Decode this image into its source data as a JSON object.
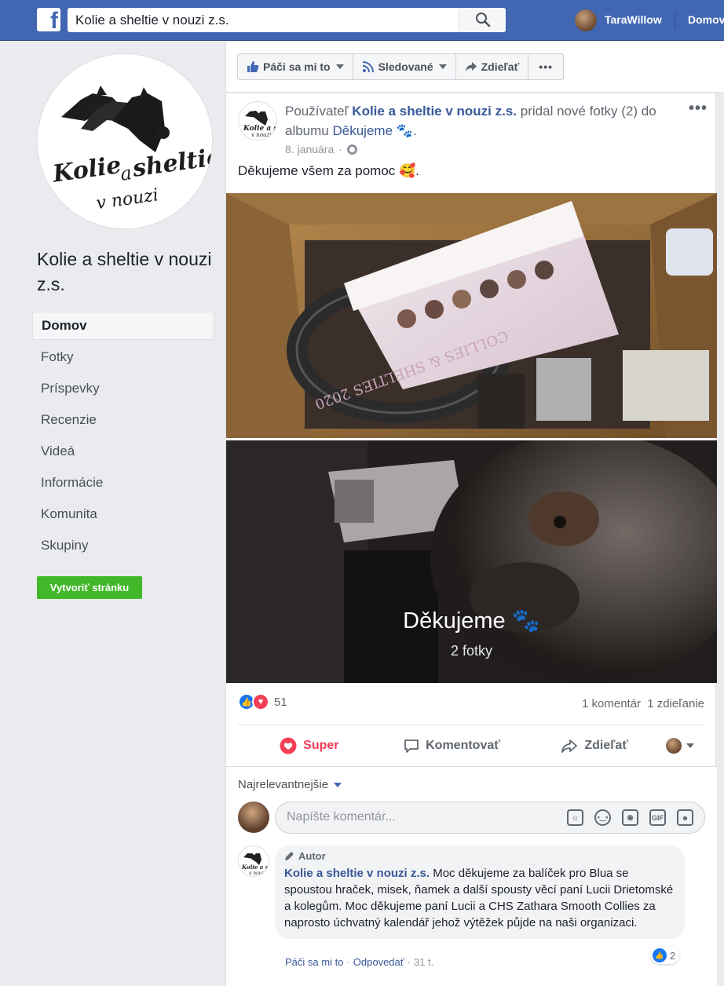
{
  "topbar": {
    "logo_letter": "f",
    "search_value": "Kolie a sheltie v nouzi z.s.",
    "user_name": "TaraWillow",
    "home_label": "Domov"
  },
  "page": {
    "name": "Kolie a sheltie v nouzi z.s.",
    "logo_text_line1": "Kolie a sheltie",
    "logo_text_line2": "v nouzi"
  },
  "nav": {
    "items": [
      {
        "label": "Domov",
        "active": true
      },
      {
        "label": "Fotky"
      },
      {
        "label": "Príspevky"
      },
      {
        "label": "Recenzie"
      },
      {
        "label": "Videá"
      },
      {
        "label": "Informácie"
      },
      {
        "label": "Komunita"
      },
      {
        "label": "Skupiny"
      }
    ],
    "create_button": "Vytvoriť stránku"
  },
  "actionbar": {
    "like_label": "Páči sa mi to",
    "follow_label": "Sledované",
    "share_label": "Zdieľať",
    "more_label": "•••"
  },
  "post": {
    "header_prefix": "Používateľ",
    "author": "Kolie a sheltie v nouzi z.s.",
    "header_middle": "pridal nové fotky (2) do albumu",
    "album_link": "Děkujeme",
    "header_suffix": "🐾.",
    "date": "8. januára",
    "more_dots": "•••",
    "text": "Děkujeme všem za pomoc 🥰.",
    "album_title": "Děkujeme 🐾",
    "album_count": "2 fotky",
    "reaction_count": "51",
    "comments_count": "1 komentár",
    "shares_count": "1 zdieľanie",
    "actions": {
      "super": "Super",
      "comment": "Komentovať",
      "share": "Zdieľať"
    }
  },
  "comments": {
    "sort_label": "Najrelevantnejšie",
    "input_placeholder": "Napíšte komentár...",
    "icons": [
      "sticker-icon",
      "emoji-icon",
      "camera-icon",
      "gif-icon",
      "sticker-face-icon"
    ],
    "gif_label": "GIF",
    "items": [
      {
        "badge": "Autor",
        "author": "Kolie a sheltie v nouzi z.s.",
        "text": "Moc děkujeme za balíček pro Blua se spoustou hraček, misek, ňamek a další spousty věcí paní Lucii Drietomské a kolegům. Moc děkujeme paní Lucii a CHS Zathara Smooth Collies za naprosto úchvatný kalendář jehož výtěžek půjde na naši organizaci.",
        "like_label": "Páči sa mi to",
        "reply_label": "Odpovedať",
        "time": "31 t.",
        "reaction_count": "2"
      }
    ]
  },
  "colors": {
    "brand": "#4267b2",
    "link": "#385898",
    "create_button": "#42b72a",
    "love": "#f33e58",
    "like": "#1877f2"
  }
}
